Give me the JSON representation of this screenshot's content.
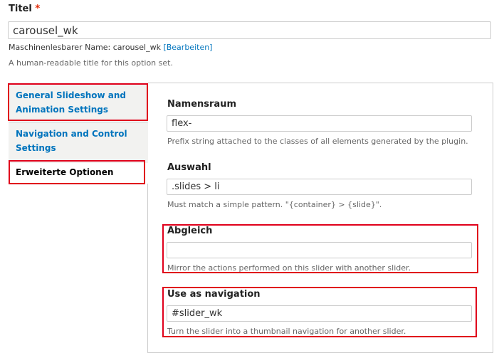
{
  "title_field": {
    "label": "Titel",
    "required_mark": "*",
    "value": "carousel_wk",
    "machine_name_prefix": "Maschinenlesbarer Name: carousel_wk",
    "machine_name_link": "[Bearbeiten]",
    "description": "A human-readable title for this option set."
  },
  "tabs": [
    {
      "label": "General Slideshow and Animation Settings"
    },
    {
      "label": "Navigation and Control Settings"
    },
    {
      "label": "Erweiterte Optionen",
      "selected": true
    }
  ],
  "fields": {
    "namespace": {
      "label": "Namensraum",
      "value": "flex-",
      "description": "Prefix string attached to the classes of all elements generated by the plugin."
    },
    "selector": {
      "label": "Auswahl",
      "value": ".slides > li",
      "description": "Must match a simple pattern. \"{container} > {slide}\"."
    },
    "sync": {
      "label": "Abgleich",
      "value": "",
      "description": "Mirror the actions performed on this slider with another slider."
    },
    "as_nav_for": {
      "label": "Use as navigation",
      "value": "#slider_wk",
      "description": "Turn the slider into a thumbnail navigation for another slider."
    }
  },
  "colors": {
    "link": "#0074bd",
    "highlight": "#e0001b",
    "required": "#e32700"
  }
}
